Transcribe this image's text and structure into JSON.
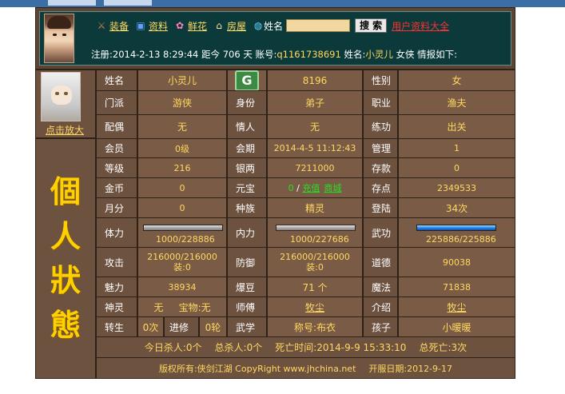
{
  "header": {
    "menu": [
      {
        "icon": "equipment-icon",
        "label": "装备"
      },
      {
        "icon": "profile-icon",
        "label": "资料"
      },
      {
        "icon": "flower-icon",
        "label": "鲜花"
      },
      {
        "icon": "house-icon",
        "label": "房屋"
      }
    ],
    "search_label": "姓名",
    "search_value": "",
    "search_button": "搜 索",
    "all_profiles_link": "用户资料大全",
    "reg_prefix": "注册:",
    "reg_date": "2014-2-13 8:29:44",
    "reg_since_label": "距今",
    "reg_days": "706",
    "reg_days_unit": "天",
    "account_label": "账号:",
    "account_value": "q1161738691",
    "name_label": "姓名:",
    "name_value": "小灵儿",
    "gender_text": "女侠",
    "report_text": "情报如下:"
  },
  "portrait": {
    "zoom_link": "点击放大"
  },
  "side_title": [
    "個",
    "人",
    "狀",
    "態"
  ],
  "rows": {
    "r1": {
      "l1": "姓名",
      "v1": "小灵儿",
      "v2": "8196",
      "l3": "性别",
      "v3": "女"
    },
    "r2": {
      "l1": "门派",
      "v1": "游侠",
      "l2": "身份",
      "v2": "弟子",
      "l3": "职业",
      "v3": "渔夫"
    },
    "r3": {
      "l1": "配偶",
      "v1": "无",
      "l2": "情人",
      "v2": "无",
      "l3": "练功",
      "v3": "出关"
    },
    "r4": {
      "l1": "会员",
      "v1": "0级",
      "l2": "会期",
      "v2": "2014-4-5 11:12:43",
      "l3": "管理",
      "v3": "1"
    },
    "r5": {
      "l1": "等级",
      "v1": "216",
      "l2": "银两",
      "v2": "7211000",
      "l3": "存款",
      "v3": "0"
    },
    "r6": {
      "l1": "金币",
      "v1": "0",
      "l2": "元宝",
      "v2_a": "0",
      "v2_sep": " / ",
      "v2_b": "充值",
      "v2_c": "商城",
      "l3": "存点",
      "v3": "2349533"
    },
    "r7": {
      "l1": "月分",
      "v1": "0",
      "l2": "种族",
      "v2": "精灵",
      "l3": "登陆",
      "v3": "34次"
    },
    "r8": {
      "l1": "体力",
      "v1": "1000/228886",
      "l2": "内力",
      "v2": "1000/227686",
      "l3": "武功",
      "v3": "225886/225886"
    },
    "r9": {
      "l1": "攻击",
      "v1_a": "216000/216000",
      "v1_b": "装:0",
      "l2": "防御",
      "v2_a": "216000/216000",
      "v2_b": "装:0",
      "l3": "道德",
      "v3": "90038"
    },
    "r10": {
      "l1": "魅力",
      "v1": "38934",
      "l2": "爆豆",
      "v2": "71 个",
      "l3": "魔法",
      "v3": "71838"
    },
    "r11": {
      "l1": "神灵",
      "v1_a": "无",
      "v1_b": "宝物:无",
      "l2": "师傅",
      "v2": "牧尘",
      "l3": "介绍",
      "v3": "牧尘"
    },
    "r12": {
      "l1": "转生",
      "v1_a": "0次",
      "v1_lab": "进修",
      "v1_b": "0轮",
      "l2": "武学",
      "v2": "称号:布衣",
      "l3": "孩子",
      "v3": "小暖暖"
    }
  },
  "bars": {
    "hp_fill": 0.0044,
    "mp_fill": 0.0044,
    "wg_fill": 1.0
  },
  "footer": {
    "kills_today": "今日杀人:0个",
    "kills_total": "总杀人:0个",
    "death_time": "死亡时间:2014-9-9 15:33:10",
    "deaths_total": "总死亡:3次",
    "copyright": "版权所有:侠剑江湖 CopyRight www.jhchina.net",
    "open_date": "开服日期:2012-9-17"
  },
  "colors": {
    "value": "#ffd860",
    "label": "#ffffff",
    "panel": "#7a5c46",
    "frame": "#5b4636"
  }
}
